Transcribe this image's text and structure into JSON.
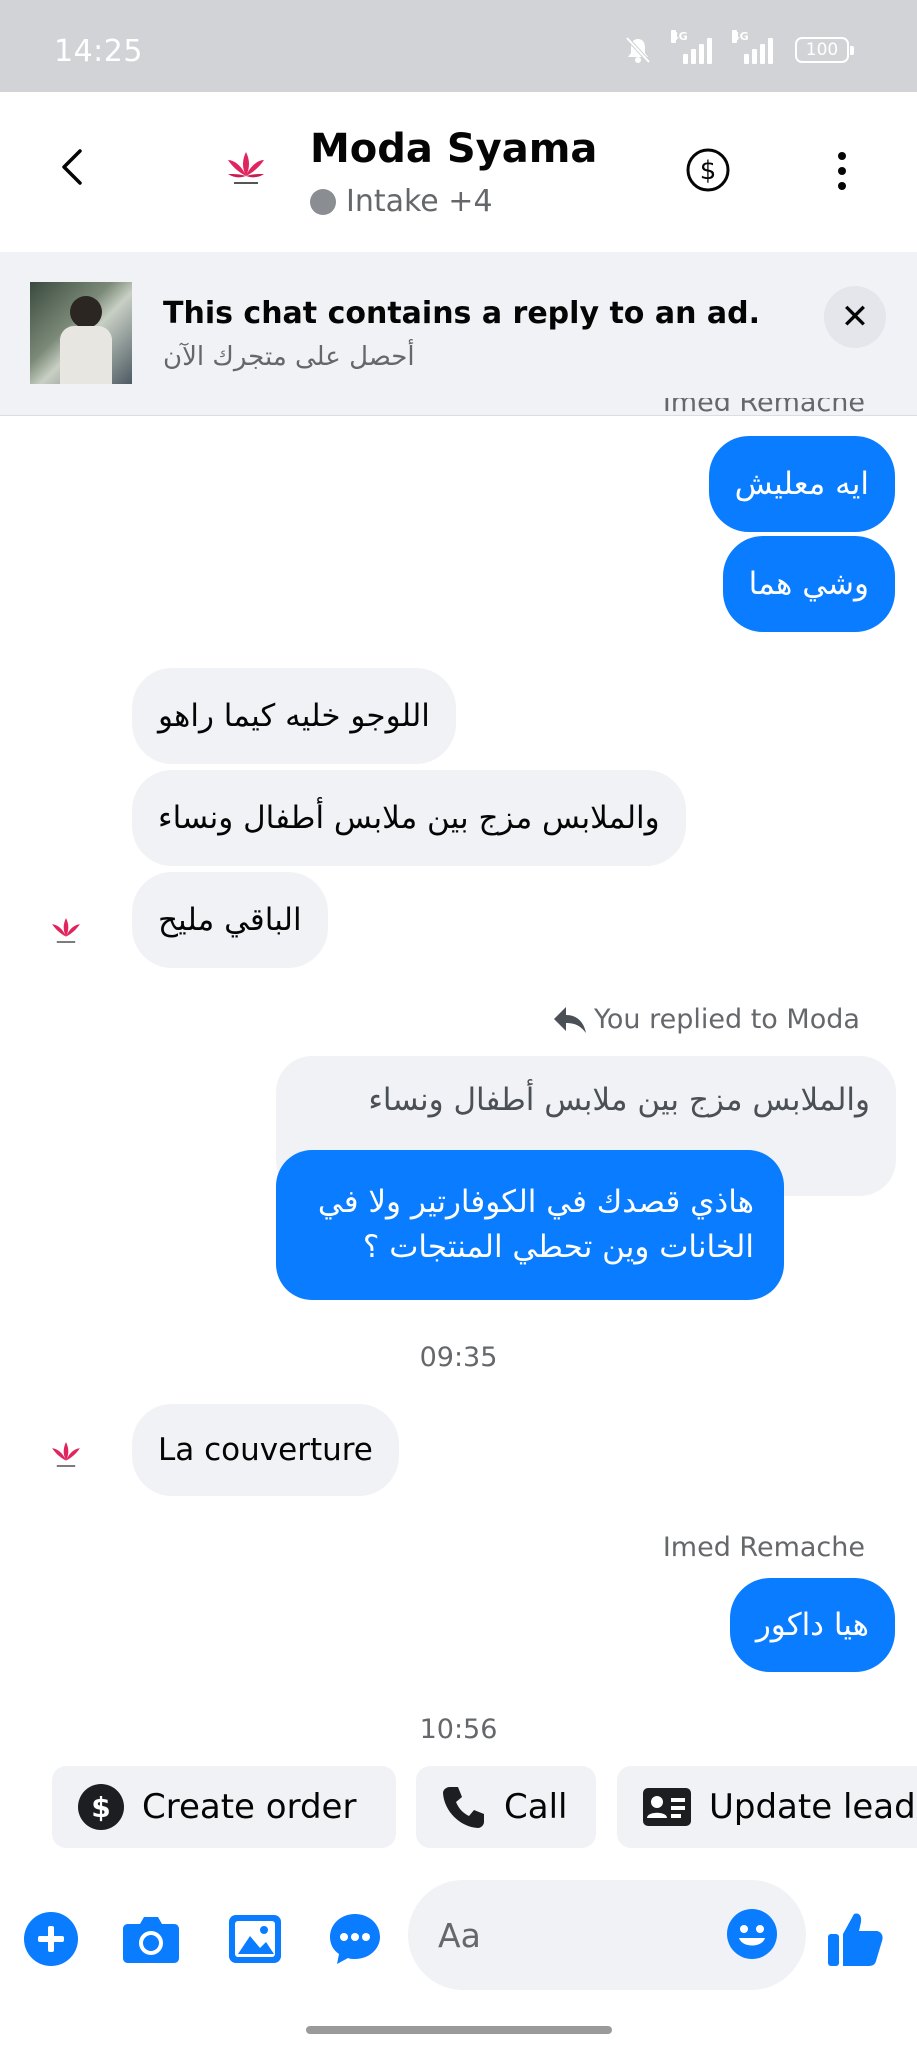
{
  "status_bar": {
    "time": "14:25",
    "network_1": "4G",
    "network_2": "4G",
    "battery": "100"
  },
  "header": {
    "title": "Moda Syama",
    "subtitle": "Intake +4",
    "icons": [
      "back-arrow-icon",
      "lotus-logo",
      "dollar-circle-icon",
      "more-vertical-icon"
    ]
  },
  "banner": {
    "title": "This chat contains a reply to an ad.",
    "subtitle": "أحصل على متجرك الآن",
    "close_label": "✕"
  },
  "messages": {
    "cut_sender": "Imed Remache",
    "m1": "ايه معليش",
    "m2": "وشي هما",
    "m3": "اللوجو خليه كيما راهو",
    "m4": "والملابس مزج بين ملابس أطفال ونساء",
    "m5": "الباقي مليح",
    "reply_label": "You replied to Moda",
    "quoted": "والملابس مزج بين ملابس أطفال ونساء",
    "m6_line1": "هاذي قصدك في الكوفارتير ولا في",
    "m6_line2": "الخانات وين تحطي المنتجات ؟",
    "time1": "09:35",
    "m7": "La couverture",
    "sender": "Imed Remache",
    "m8": "هيا داكور",
    "time2": "10:56"
  },
  "actions": {
    "create_order": "Create order",
    "call": "Call",
    "update_lead": "Update lead"
  },
  "composer": {
    "placeholder": "Aa"
  },
  "colors": {
    "accent": "#0a7cff",
    "bubble_in": "#f0f2f5",
    "status_bar": "#d1d3d6",
    "logo_pink": "#e0245e"
  }
}
